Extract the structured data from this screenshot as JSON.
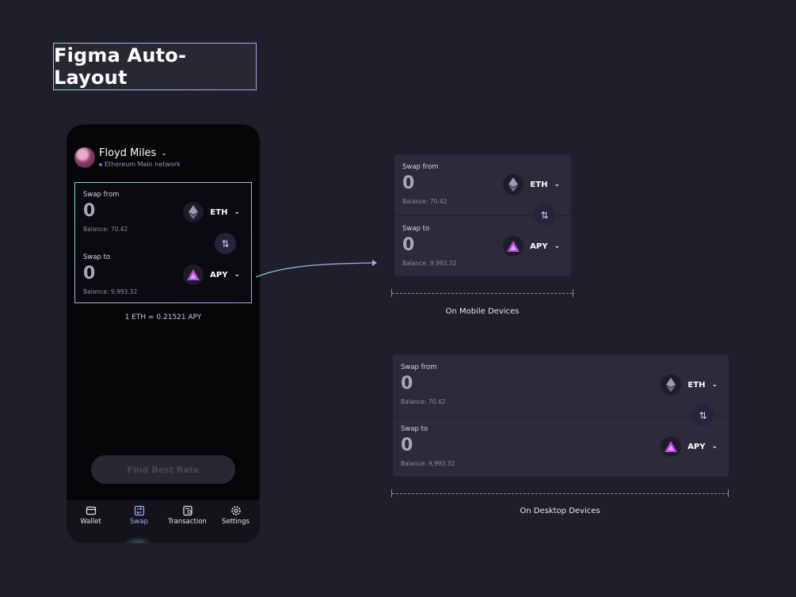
{
  "title": "Figma Auto-Layout",
  "phone": {
    "user_name": "Floyd Miles",
    "network": "Ethereum Main network",
    "rate": "1  ETH = 0.21521 APY",
    "find_button": "Find Best Rate",
    "tabs": [
      {
        "label": "Wallet",
        "icon": "wallet-icon"
      },
      {
        "label": "Swap",
        "icon": "swap-icon"
      },
      {
        "label": "Transaction",
        "icon": "transaction-icon"
      },
      {
        "label": "Settings",
        "icon": "gear-icon"
      }
    ]
  },
  "swap": {
    "from_label": "Swap from",
    "from_amount": "0",
    "from_token": "ETH",
    "from_balance": "Balance: 70.42",
    "to_label": "Swap to",
    "to_amount": "0",
    "to_token": "APY",
    "to_balance": "Balance: 9,993.32"
  },
  "captions": {
    "mobile": "On Mobile Devices",
    "desktop": "On Desktop Devices"
  },
  "colors": {
    "background": "#211e2b",
    "card": "#2d2a3a",
    "accent": "#a5b0ff",
    "border_gradient_start": "#7fdcc8",
    "border_gradient_end": "#b89cf5"
  }
}
